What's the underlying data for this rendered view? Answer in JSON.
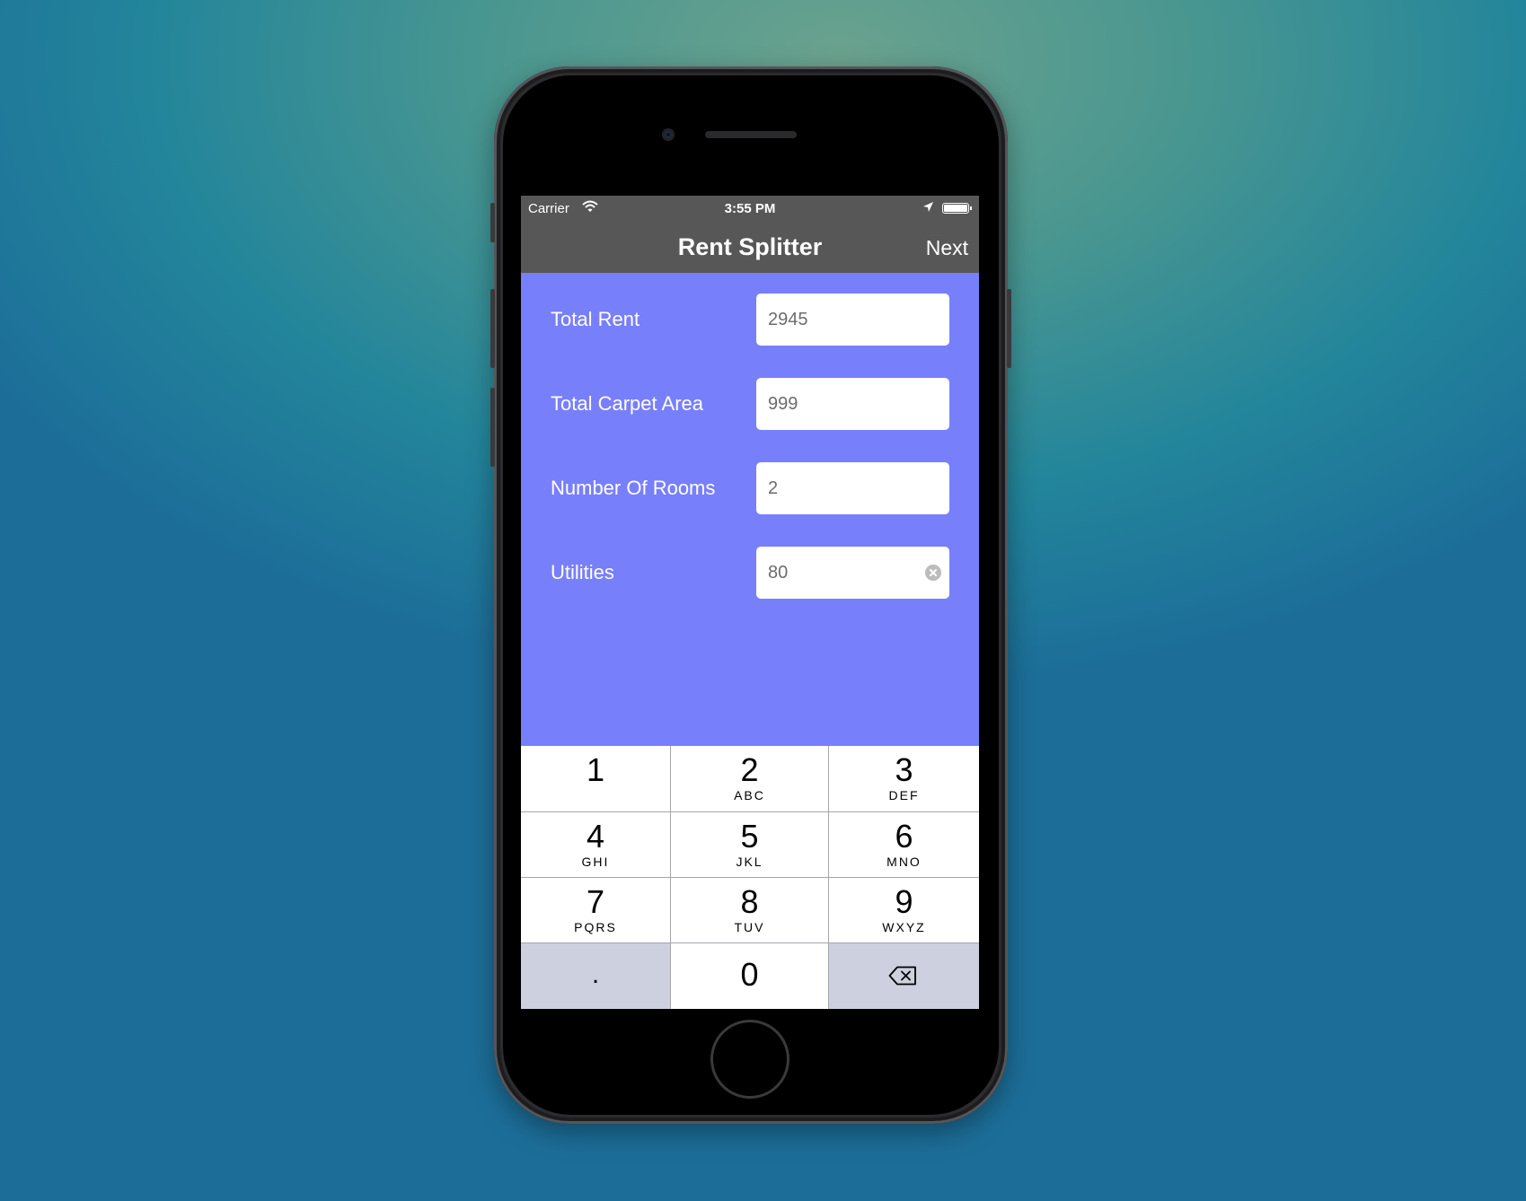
{
  "status_bar": {
    "carrier": "Carrier",
    "time": "3:55 PM"
  },
  "nav": {
    "title": "Rent Splitter",
    "next_label": "Next"
  },
  "form": {
    "fields": [
      {
        "label": "Total Rent",
        "value": "2945"
      },
      {
        "label": "Total Carpet Area",
        "value": "999"
      },
      {
        "label": "Number Of Rooms",
        "value": "2"
      },
      {
        "label": "Utilities",
        "value": "80"
      }
    ]
  },
  "keyboard": {
    "keys": [
      {
        "num": "1",
        "letters": ""
      },
      {
        "num": "2",
        "letters": "ABC"
      },
      {
        "num": "3",
        "letters": "DEF"
      },
      {
        "num": "4",
        "letters": "GHI"
      },
      {
        "num": "5",
        "letters": "JKL"
      },
      {
        "num": "6",
        "letters": "MNO"
      },
      {
        "num": "7",
        "letters": "PQRS"
      },
      {
        "num": "8",
        "letters": "TUV"
      },
      {
        "num": "9",
        "letters": "WXYZ"
      }
    ],
    "decimal": ".",
    "zero": "0"
  },
  "colors": {
    "form_background": "#787ffa",
    "nav_background": "#575757",
    "special_key": "#cdd0de"
  },
  "icons": [
    "wifi-icon",
    "location-arrow-icon",
    "battery-icon",
    "clear-icon",
    "backspace-icon"
  ]
}
